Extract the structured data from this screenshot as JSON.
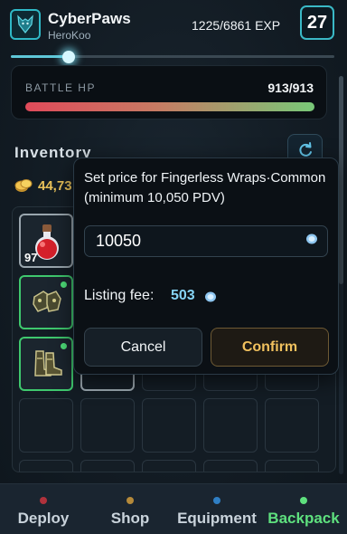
{
  "header": {
    "player_name": "CyberPaws",
    "player_sub": "HeroKoo",
    "exp_text": "1225/6861 EXP",
    "level": "27",
    "exp_progress": 0.18,
    "avatar_icon": "wolf-emblem-icon"
  },
  "battle": {
    "label": "BATTLE HP",
    "value": "913/913",
    "hp_fraction": 1.0
  },
  "inventory": {
    "title": "Inventory",
    "coins": "44,73",
    "refresh_icon": "refresh-icon",
    "slots": [
      {
        "item": "red-potion",
        "qty": "97",
        "selected": true
      },
      {
        "item": "fingerless-wraps",
        "qty": "",
        "new": true
      },
      {
        "item": "boots",
        "qty": "",
        "new": true
      }
    ]
  },
  "modal": {
    "title": "Set price for Fingerless Wraps·Common (minimum 10,050 PDV)",
    "price_value": "10050",
    "fee_label": "Listing fee:",
    "fee_value": "503",
    "cancel_label": "Cancel",
    "confirm_label": "Confirm"
  },
  "nav": {
    "items": [
      {
        "label": "Deploy",
        "color": "#c9d3db",
        "dot": "#b0323c",
        "active": false
      },
      {
        "label": "Shop",
        "color": "#c9d3db",
        "dot": "#b58a3a",
        "active": false
      },
      {
        "label": "Equipment",
        "color": "#c9d3db",
        "dot": "#2f7fc4",
        "active": false
      },
      {
        "label": "Backpack",
        "color": "#5ee07e",
        "dot": "#5ee07e",
        "active": true
      }
    ]
  },
  "colors": {
    "accent": "#3ab9c6",
    "gold": "#e9c25a",
    "confirm": "#f1c15e",
    "active_green": "#5ee07e"
  }
}
